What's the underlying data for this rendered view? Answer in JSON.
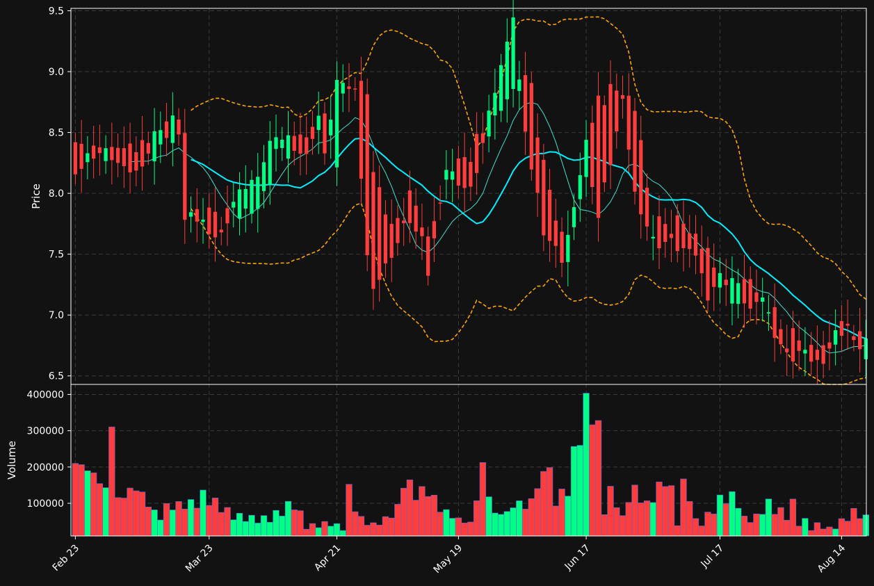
{
  "colors": {
    "background": "#121212",
    "up": "#00ff85",
    "down": "#ff3d3d",
    "axis": "#ffffff",
    "grid": "#3a3a3a",
    "ma_fast": "#40e0d0",
    "ma_slow": "#00f0ff",
    "band": "#ffa500",
    "volume_edge": "#4a6bd8"
  },
  "chart_data": {
    "type": "candlestick",
    "ylabel": "Price",
    "ylabel_volume": "Volume",
    "price_ticks": [
      6.5,
      7.0,
      7.5,
      8.0,
      8.5,
      9.0,
      9.5
    ],
    "price_tick_labels": [
      "6.5",
      "7.0",
      "7.5",
      "8.0",
      "8.5",
      "9.0",
      "9.5"
    ],
    "volume_ticks": [
      100000,
      200000,
      300000,
      400000
    ],
    "volume_tick_labels": [
      "100000",
      "200000",
      "300000",
      "400000"
    ],
    "x_tick_labels": [
      "Feb 23",
      "Mar 23",
      "Apr 21",
      "May 19",
      "Jun 17",
      "Jul 17",
      "Aug 14"
    ],
    "x_tick_index": [
      0,
      22,
      43,
      63,
      84,
      106,
      126
    ],
    "ylim": [
      6.43,
      9.52
    ],
    "ylim_volume": [
      10000,
      420000
    ],
    "n_points": 131,
    "grid": true,
    "anchors": {
      "open": [
        [
          0,
          8.38
        ],
        [
          4,
          8.33
        ],
        [
          10,
          8.4
        ],
        [
          14,
          8.35
        ],
        [
          15,
          8.55
        ],
        [
          16,
          8.48
        ],
        [
          17,
          8.58
        ],
        [
          18,
          8.5
        ],
        [
          19,
          7.8
        ],
        [
          20,
          7.85
        ],
        [
          24,
          7.8
        ],
        [
          26,
          7.85
        ],
        [
          30,
          7.85
        ],
        [
          33,
          8.3
        ],
        [
          38,
          8.5
        ],
        [
          40,
          8.55
        ],
        [
          41,
          8.62
        ],
        [
          43,
          8.3
        ],
        [
          44,
          8.75
        ],
        [
          46,
          8.95
        ],
        [
          48,
          8.8
        ],
        [
          49,
          8.2
        ],
        [
          52,
          7.7
        ],
        [
          55,
          7.95
        ],
        [
          57,
          7.8
        ],
        [
          58,
          7.6
        ],
        [
          61,
          8.1
        ],
        [
          65,
          8.35
        ],
        [
          69,
          8.6
        ],
        [
          72,
          8.85
        ],
        [
          73,
          8.9
        ],
        [
          75,
          8.9
        ],
        [
          77,
          8.2
        ],
        [
          80,
          7.65
        ],
        [
          81,
          7.45
        ],
        [
          84,
          8.2
        ],
        [
          86,
          8.8
        ],
        [
          90,
          8.85
        ],
        [
          92,
          8.7
        ],
        [
          93,
          8.4
        ],
        [
          95,
          7.7
        ],
        [
          97,
          7.75
        ],
        [
          100,
          7.75
        ],
        [
          102,
          7.65
        ],
        [
          104,
          7.5
        ],
        [
          106,
          7.3
        ],
        [
          108,
          7.1
        ],
        [
          111,
          7.3
        ],
        [
          113,
          7.1
        ],
        [
          115,
          7.0
        ],
        [
          117,
          6.8
        ],
        [
          119,
          6.8
        ],
        [
          121,
          6.7
        ],
        [
          123,
          6.75
        ],
        [
          125,
          6.8
        ],
        [
          127,
          6.95
        ],
        [
          128,
          6.9
        ],
        [
          130,
          6.65
        ]
      ],
      "close": [
        [
          0,
          8.18
        ],
        [
          4,
          8.36
        ],
        [
          10,
          8.15
        ],
        [
          14,
          8.55
        ],
        [
          15,
          8.48
        ],
        [
          16,
          8.6
        ],
        [
          17,
          8.5
        ],
        [
          18,
          7.78
        ],
        [
          19,
          7.85
        ],
        [
          20,
          7.78
        ],
        [
          24,
          7.62
        ],
        [
          26,
          7.95
        ],
        [
          30,
          8.15
        ],
        [
          33,
          8.5
        ],
        [
          38,
          8.3
        ],
        [
          40,
          8.62
        ],
        [
          41,
          8.35
        ],
        [
          43,
          8.88
        ],
        [
          44,
          8.95
        ],
        [
          46,
          8.8
        ],
        [
          48,
          7.5
        ],
        [
          49,
          7.2
        ],
        [
          52,
          7.5
        ],
        [
          55,
          7.8
        ],
        [
          57,
          7.6
        ],
        [
          58,
          7.35
        ],
        [
          61,
          8.2
        ],
        [
          65,
          8.0
        ],
        [
          69,
          8.85
        ],
        [
          72,
          9.45
        ],
        [
          73,
          8.9
        ],
        [
          75,
          8.2
        ],
        [
          77,
          7.7
        ],
        [
          80,
          7.45
        ],
        [
          81,
          7.65
        ],
        [
          84,
          8.4
        ],
        [
          86,
          7.8
        ],
        [
          90,
          8.75
        ],
        [
          92,
          8.0
        ],
        [
          93,
          7.85
        ],
        [
          95,
          7.6
        ],
        [
          97,
          7.6
        ],
        [
          100,
          7.55
        ],
        [
          102,
          7.5
        ],
        [
          104,
          7.15
        ],
        [
          106,
          7.3
        ],
        [
          108,
          7.3
        ],
        [
          111,
          7.05
        ],
        [
          113,
          7.15
        ],
        [
          115,
          6.85
        ],
        [
          117,
          6.65
        ],
        [
          119,
          6.7
        ],
        [
          121,
          6.65
        ],
        [
          123,
          6.6
        ],
        [
          125,
          6.85
        ],
        [
          127,
          6.9
        ],
        [
          128,
          6.75
        ],
        [
          130,
          6.8
        ]
      ],
      "volume": [
        [
          0,
          210000
        ],
        [
          1,
          205000
        ],
        [
          3,
          180000
        ],
        [
          5,
          138000
        ],
        [
          6,
          325000
        ],
        [
          7,
          110000
        ],
        [
          10,
          145000
        ],
        [
          13,
          75000
        ],
        [
          14,
          60000
        ],
        [
          15,
          90000
        ],
        [
          20,
          100000
        ],
        [
          21,
          120000
        ],
        [
          23,
          100000
        ],
        [
          26,
          65000
        ],
        [
          30,
          55000
        ],
        [
          32,
          58000
        ],
        [
          36,
          100000
        ],
        [
          38,
          35000
        ],
        [
          42,
          45000
        ],
        [
          44,
          30000
        ],
        [
          45,
          130000
        ],
        [
          47,
          55000
        ],
        [
          49,
          40000
        ],
        [
          51,
          55000
        ],
        [
          53,
          85000
        ],
        [
          54,
          165000
        ],
        [
          56,
          125000
        ],
        [
          58,
          135000
        ],
        [
          60,
          85000
        ],
        [
          63,
          55000
        ],
        [
          65,
          45000
        ],
        [
          66,
          115000
        ],
        [
          67,
          200000
        ],
        [
          68,
          125000
        ],
        [
          69,
          70000
        ],
        [
          71,
          75000
        ],
        [
          73,
          105000
        ],
        [
          74,
          85000
        ],
        [
          76,
          140000
        ],
        [
          77,
          190000
        ],
        [
          78,
          195000
        ],
        [
          79,
          95000
        ],
        [
          80,
          135000
        ],
        [
          81,
          125000
        ],
        [
          82,
          245000
        ],
        [
          83,
          275000
        ],
        [
          84,
          380000
        ],
        [
          85,
          340000
        ],
        [
          86,
          305000
        ],
        [
          87,
          75000
        ],
        [
          88,
          135000
        ],
        [
          90,
          60000
        ],
        [
          91,
          115000
        ],
        [
          92,
          135000
        ],
        [
          94,
          95000
        ],
        [
          96,
          140000
        ],
        [
          97,
          170000
        ],
        [
          98,
          130000
        ],
        [
          99,
          45000
        ],
        [
          100,
          145000
        ],
        [
          101,
          125000
        ],
        [
          102,
          50000
        ],
        [
          103,
          45000
        ],
        [
          104,
          65000
        ],
        [
          106,
          105000
        ],
        [
          107,
          120000
        ],
        [
          109,
          105000
        ],
        [
          110,
          55000
        ],
        [
          112,
          60000
        ],
        [
          113,
          85000
        ],
        [
          114,
          95000
        ],
        [
          117,
          65000
        ],
        [
          118,
          95000
        ],
        [
          119,
          45000
        ],
        [
          120,
          50000
        ],
        [
          121,
          30000
        ],
        [
          122,
          40000
        ],
        [
          124,
          30000
        ],
        [
          125,
          35000
        ],
        [
          126,
          50000
        ],
        [
          127,
          60000
        ],
        [
          128,
          75000
        ],
        [
          130,
          60000
        ]
      ]
    }
  }
}
